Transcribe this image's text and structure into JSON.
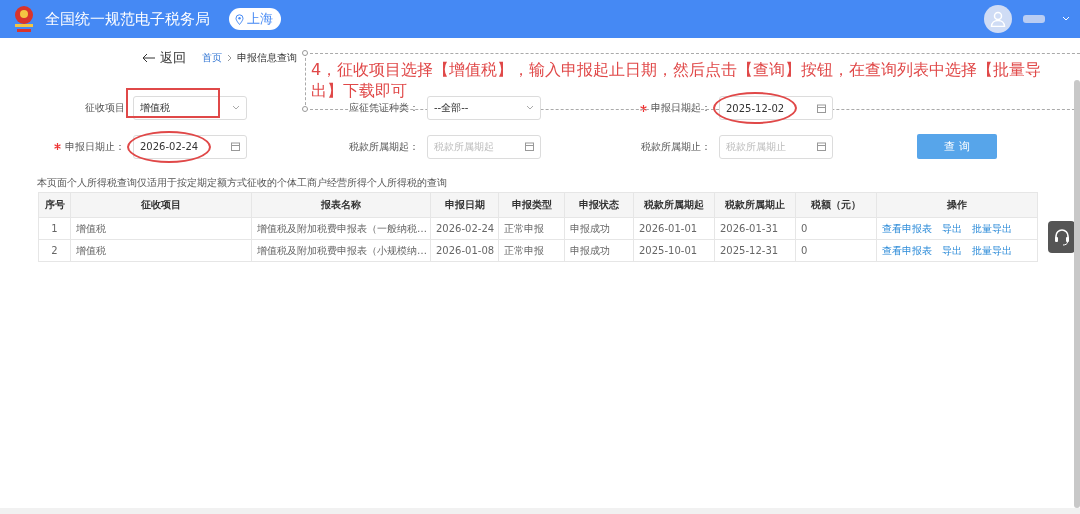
{
  "header": {
    "title": "全国统一规范电子税务局",
    "region": "上海"
  },
  "nav": {
    "back": "返回",
    "breadcrumb": [
      {
        "label": "首页",
        "link": true
      },
      {
        "label": "申报信息查询",
        "link": false
      }
    ]
  },
  "annotation": {
    "text": "4，征收项目选择【增值税】，输入申报起止日期，然后点击【查询】按钮，在查询列表中选择【批量导出】下载即可"
  },
  "form": {
    "rows": [
      [
        {
          "label": "征收项目",
          "kind": "select",
          "value": "增值税",
          "required": false,
          "highlighted": true
        },
        {
          "label": "应征凭证种类：",
          "kind": "select",
          "value": "--全部--",
          "required": false,
          "highlighted": false
        },
        {
          "label": "申报日期起：",
          "kind": "date",
          "value": "2025-12-02",
          "required": true,
          "highlighted": true
        }
      ],
      [
        {
          "label": "申报日期止：",
          "kind": "date",
          "value": "2026-02-24",
          "required": true,
          "highlighted": true
        },
        {
          "label": "税款所属期起：",
          "kind": "date",
          "placeholder": "税款所属期起",
          "required": false,
          "highlighted": false
        },
        {
          "label": "税款所属期止：",
          "kind": "date",
          "placeholder": "税款所属期止",
          "required": false,
          "highlighted": false
        }
      ]
    ],
    "button": "查 询"
  },
  "note": "本页面个人所得税查询仅适用于按定期定额方式征收的个体工商户经营所得个人所得税的查询",
  "table": {
    "columns": [
      "序号",
      "征收项目",
      "报表名称",
      "申报日期",
      "申报类型",
      "申报状态",
      "税款所属期起",
      "税款所属期止",
      "税额（元）",
      "操作"
    ],
    "rows": [
      {
        "cells": [
          "1",
          "增值税",
          "增值税及附加税费申报表（一般纳税…",
          "2026-02-24",
          "正常申报",
          "申报成功",
          "2026-01-01",
          "2026-01-31",
          "0"
        ],
        "actions": [
          "查看申报表",
          "导出",
          "批量导出"
        ]
      },
      {
        "cells": [
          "2",
          "增值税",
          "增值税及附加税费申报表（小规模纳…",
          "2026-01-08",
          "正常申报",
          "申报成功",
          "2025-10-01",
          "2025-12-31",
          "0"
        ],
        "actions": [
          "查看申报表",
          "导出",
          "批量导出"
        ]
      }
    ]
  }
}
